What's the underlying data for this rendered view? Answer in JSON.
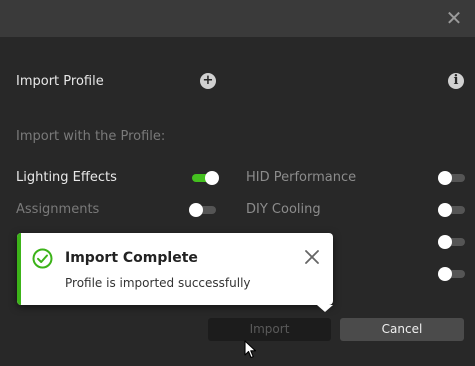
{
  "dialog": {
    "close_icon": "close-icon"
  },
  "profile": {
    "import_label": "Import Profile",
    "add_icon": "plus-circle-icon",
    "info_icon": "info-icon",
    "section_label": "Import with the Profile:"
  },
  "options": [
    {
      "label": "Lighting Effects",
      "enabled": true
    },
    {
      "label": "HID Performance",
      "enabled": false
    },
    {
      "label": "Assignments",
      "enabled": false
    },
    {
      "label": "DIY Cooling",
      "enabled": false
    },
    {
      "label": "",
      "enabled": false
    },
    {
      "label": "",
      "enabled": false
    }
  ],
  "toast": {
    "title": "Import Complete",
    "message": "Profile is imported successfully",
    "status_icon": "check-circle-icon",
    "close_icon": "close-icon",
    "accent": "#3cb319"
  },
  "buttons": {
    "import_label": "Import",
    "cancel_label": "Cancel"
  },
  "colors": {
    "toggle_on": "#44c01f",
    "background": "#282828"
  }
}
